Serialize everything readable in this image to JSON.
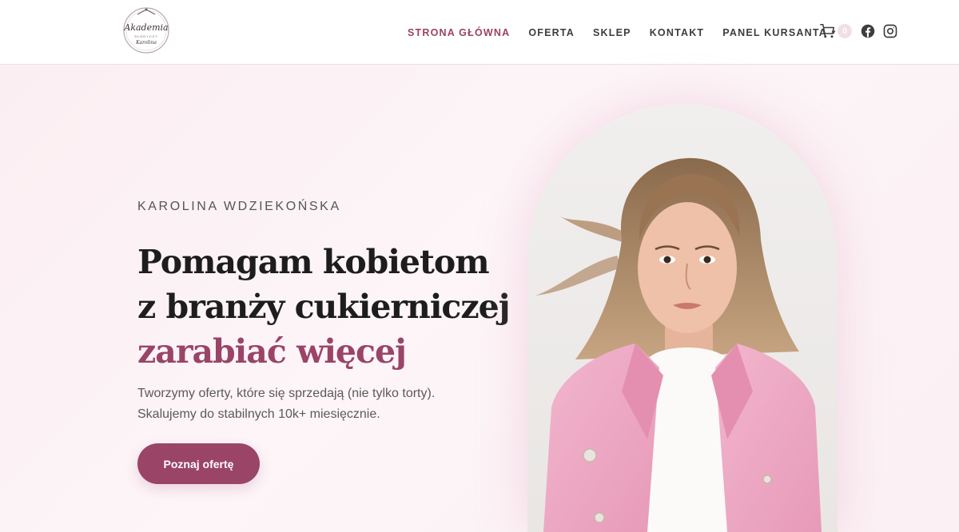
{
  "header": {
    "logo_text": "Akademia",
    "logo_sub": "SŁODYCZY",
    "logo_name": "Karolina",
    "nav": [
      {
        "label": "STRONA GŁÓWNA",
        "active": true
      },
      {
        "label": "OFERTA",
        "active": false
      },
      {
        "label": "SKLEP",
        "active": false
      },
      {
        "label": "KONTAKT",
        "active": false
      },
      {
        "label": "PANEL KURSANTA",
        "active": false,
        "has_dropdown": true
      }
    ],
    "cart_count": "0",
    "icons": [
      "cart-icon",
      "facebook-icon",
      "instagram-icon"
    ]
  },
  "hero": {
    "eyebrow": "KAROLINA WDZIEKOŃSKA",
    "headline_1": "Pomagam kobietom",
    "headline_2": "z branży cukierniczej",
    "headline_accent": "zarabiać więcej",
    "sub_1": "Tworzymy oferty, które się sprzedają (nie tylko torty).",
    "sub_2": "Skalujemy do stabilnych 10k+ miesięcznie.",
    "cta_label": "Poznaj ofertę"
  },
  "colors": {
    "accent": "#9a4468",
    "text": "#1d1d1d",
    "background": "#fbeef2",
    "header_bg": "#ffffff"
  }
}
